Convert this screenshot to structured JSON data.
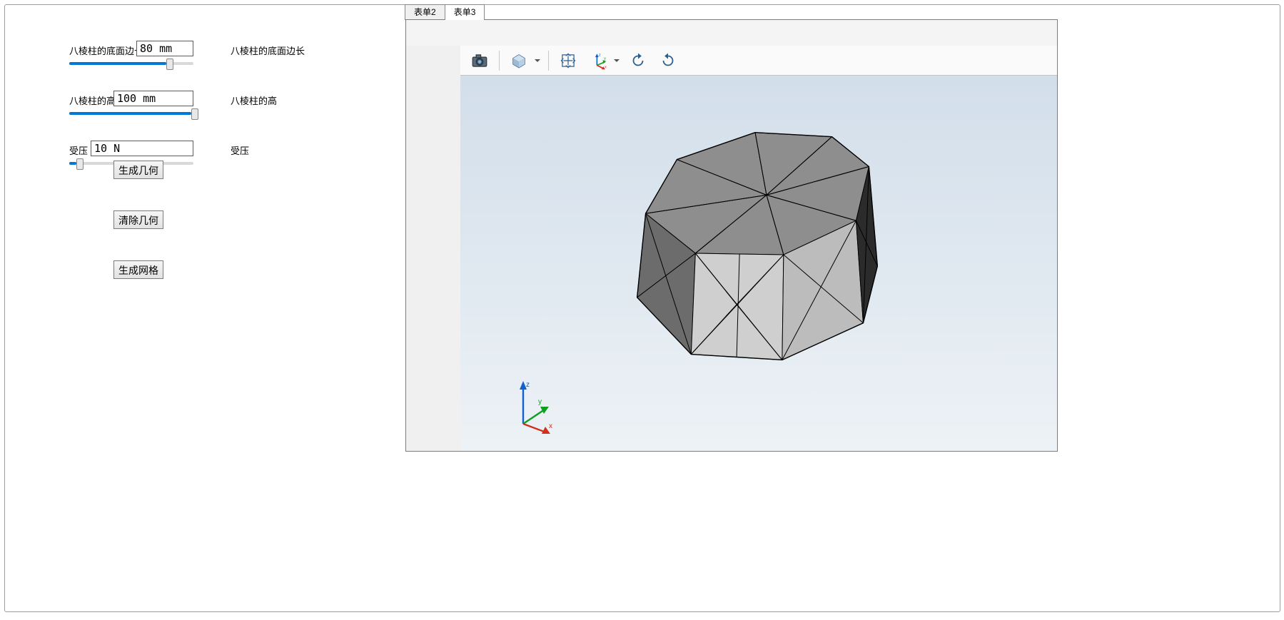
{
  "tabs": [
    {
      "label": "表单2",
      "active": false
    },
    {
      "label": "表单3",
      "active": true
    }
  ],
  "params": {
    "edge": {
      "label": "八棱柱的底面边长",
      "value": "80 mm",
      "desc": "八棱柱的底面边长",
      "slider_pct": 78
    },
    "height": {
      "label": "八棱柱的高",
      "value": "100 mm",
      "desc": "八棱柱的高",
      "slider_pct": 98
    },
    "pressure": {
      "label": "受压",
      "value": "10 N",
      "desc": "受压",
      "slider_pct": 6
    }
  },
  "buttons": {
    "generate_geometry": "生成几何",
    "clear_geometry": "清除几何",
    "generate_mesh": "生成网格"
  },
  "viewport": {
    "toolbar_icons": [
      "camera-icon",
      "view-cube-icon",
      "zoom-extents-icon",
      "axis-orientation-icon",
      "rotate-ccw-icon",
      "rotate-cw-icon"
    ],
    "axis_labels": {
      "x": "x",
      "y": "y",
      "z": "z"
    },
    "model": "octagonal prism mesh"
  }
}
